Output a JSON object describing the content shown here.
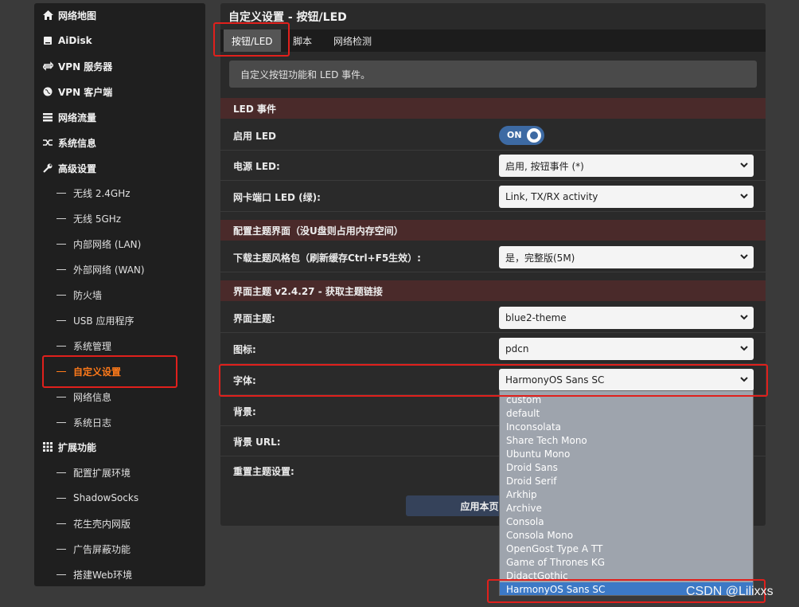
{
  "sidebar": {
    "items": [
      {
        "label": "网络地图",
        "icon": "home-icon"
      },
      {
        "label": "AiDisk",
        "icon": "disk-icon"
      },
      {
        "label": "VPN 服务器",
        "icon": "vpn-server-icon"
      },
      {
        "label": "VPN 客户端",
        "icon": "globe-icon"
      },
      {
        "label": "网络流量",
        "icon": "traffic-icon"
      },
      {
        "label": "系统信息",
        "icon": "shuffle-icon"
      },
      {
        "label": "高级设置",
        "icon": "wrench-icon"
      }
    ],
    "advanced_sub": [
      "无线 2.4GHz",
      "无线 5GHz",
      "内部网络 (LAN)",
      "外部网络 (WAN)",
      "防火墙",
      "USB 应用程序",
      "系统管理",
      "自定义设置",
      "网络信息",
      "系统日志"
    ],
    "extensions": {
      "label": "扩展功能",
      "icon": "grid-icon"
    },
    "extensions_sub": [
      "配置扩展环境",
      "ShadowSocks",
      "花生壳内网版",
      "广告屏蔽功能",
      "搭建Web环境"
    ],
    "active_item": "自定义设置",
    "active_color": "#ff7a1a"
  },
  "panel": {
    "title": "自定义设置 - 按钮/LED",
    "tabs": [
      "按钮/LED",
      "脚本",
      "网络检测"
    ],
    "description": "自定义按钮功能和 LED 事件。",
    "sections": {
      "led": "LED 事件",
      "theme_config": "配置主题界面（没U盘则占用内存空间）",
      "theme": "界面主题 v2.4.27 - 获取主题链接"
    },
    "rows": {
      "enable_led": {
        "label": "启用 LED",
        "toggle": "ON"
      },
      "power_led": {
        "label": "电源 LED:",
        "value": "启用, 按钮事件 (*)"
      },
      "port_led": {
        "label": "网卡端口 LED (绿):",
        "value": "Link, TX/RX activity"
      },
      "download_theme": {
        "label": "下载主题风格包（刷新缓存Ctrl+F5生效）:",
        "value": "是，完整版(5M)"
      },
      "ui_theme": {
        "label": "界面主题:",
        "value": "blue2-theme"
      },
      "icon": {
        "label": "图标:",
        "value": "pdcn"
      },
      "font": {
        "label": "字体:",
        "value": "HarmonyOS Sans SC"
      },
      "background": {
        "label": "背景:"
      },
      "background_url": {
        "label": "背景 URL:"
      },
      "reset_theme": {
        "label": "重置主题设置:"
      }
    },
    "apply_button": "应用本页"
  },
  "font_dropdown": {
    "options": [
      "custom",
      "default",
      "Inconsolata",
      "Share Tech Mono",
      "Ubuntu Mono",
      "Droid Sans",
      "Droid Serif",
      "Arkhip",
      "Archive",
      "Consola",
      "Consola Mono",
      "OpenGost Type A TT",
      "Game of Thrones KG",
      "DidactGothic",
      "HarmonyOS Sans SC"
    ],
    "selected": "HarmonyOS Sans SC"
  },
  "watermark": "CSDN @Lilixxs",
  "colors": {
    "accent": "#3c79c6",
    "highlight": "#e0201c",
    "section_bg": "#4a2a2a"
  }
}
